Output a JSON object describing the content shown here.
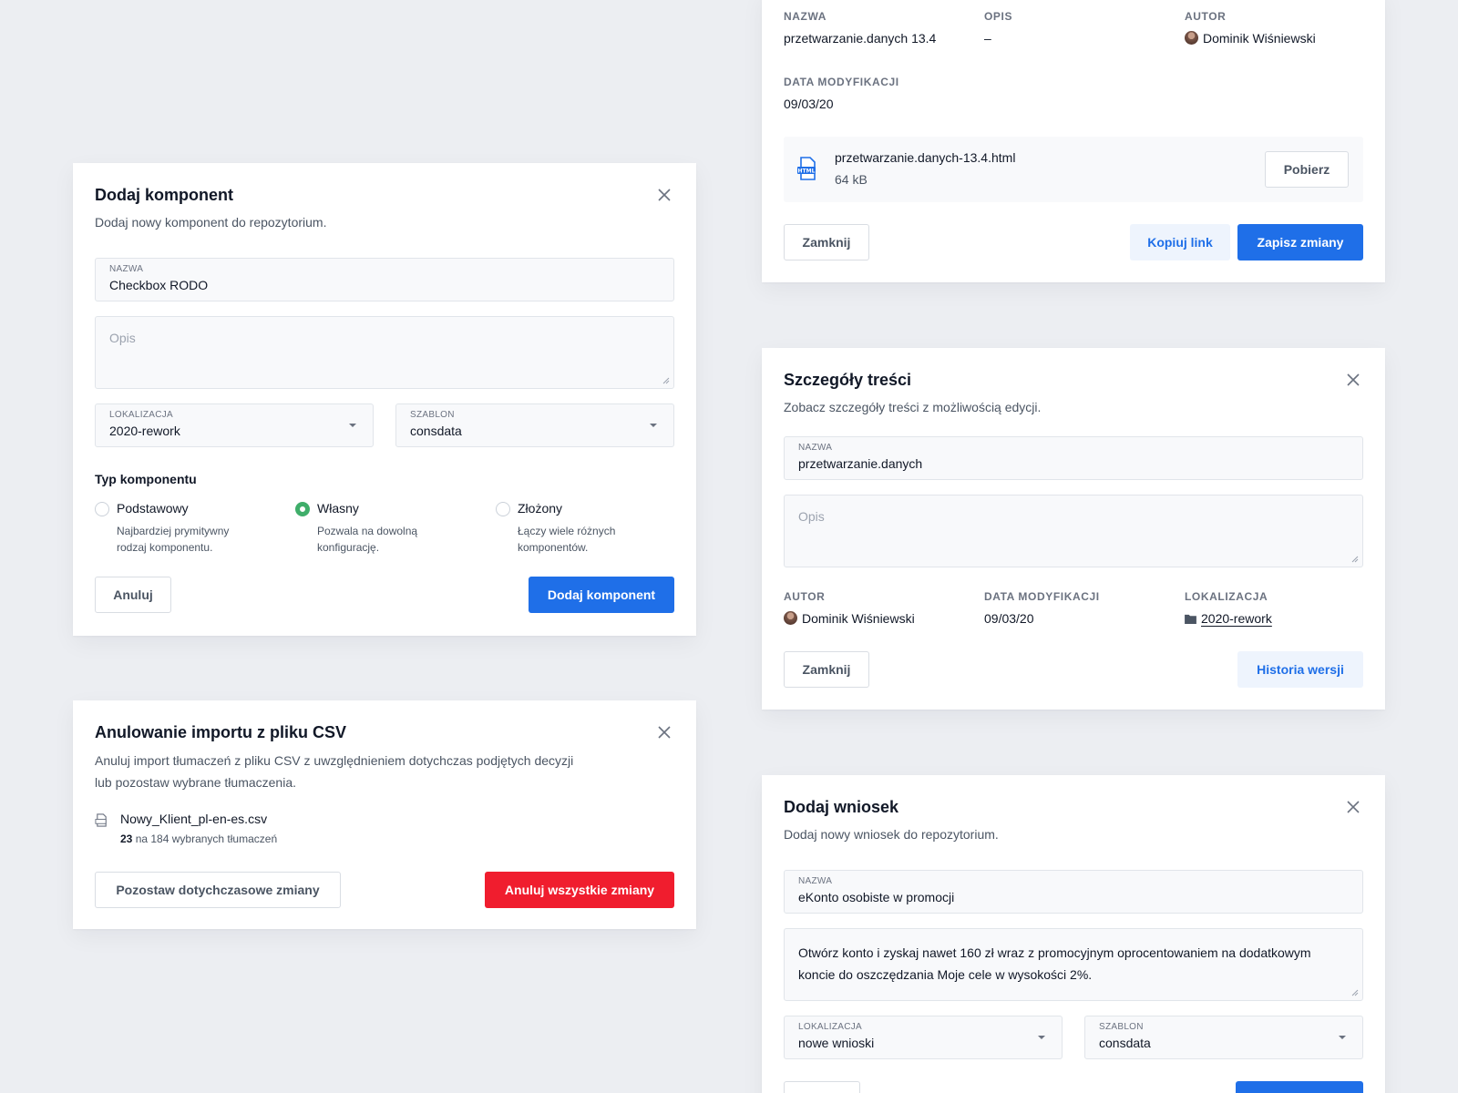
{
  "add_component": {
    "title": "Dodaj komponent",
    "subtitle": "Dodaj nowy komponent do repozytorium.",
    "name_label": "NAZWA",
    "name_value": "Checkbox RODO",
    "desc_placeholder": "Opis",
    "location_label": "LOKALIZACJA",
    "location_value": "2020-rework",
    "template_label": "SZABLON",
    "template_value": "consdata",
    "type_heading": "Typ komponentu",
    "types": [
      {
        "label": "Podstawowy",
        "desc1": "Najbardziej prymitywny",
        "desc2": "rodzaj komponentu.",
        "selected": false
      },
      {
        "label": "Własny",
        "desc1": "Pozwala na dowolną",
        "desc2": "konfigurację.",
        "selected": true
      },
      {
        "label": "Złożony",
        "desc1": "Łączy wiele różnych",
        "desc2": "komponentów.",
        "selected": false
      }
    ],
    "cancel_label": "Anuluj",
    "submit_label": "Dodaj komponent"
  },
  "cancel_import": {
    "title": "Anulowanie importu z pliku CSV",
    "subtitle_line1": "Anuluj import tłumaczeń z pliku CSV z uwzględnieniem dotychczas podjętych decyzji",
    "subtitle_line2": "lub pozostaw wybrane tłumaczenia.",
    "file_name": "Nowy_Klient_pl-en-es.csv",
    "count_selected": "23",
    "count_text": "na 184 wybranych tłumaczeń",
    "keep_label": "Pozostaw dotychczasowe zmiany",
    "cancel_all_label": "Anuluj wszystkie zmiany"
  },
  "file_details": {
    "name_label": "NAZWA",
    "name_value": "przetwarzanie.danych 13.4",
    "desc_label": "OPIS",
    "desc_value": "–",
    "author_label": "AUTOR",
    "author_value": "Dominik Wiśniewski",
    "modified_label": "DATA MODYFIKACJI",
    "modified_value": "09/03/20",
    "file_name": "przetwarzanie.danych-13.4.html",
    "file_size": "64 kB",
    "download_label": "Pobierz",
    "close_label": "Zamknij",
    "copy_link_label": "Kopiuj link",
    "save_label": "Zapisz zmiany"
  },
  "content_details": {
    "title": "Szczegóły treści",
    "subtitle": "Zobacz szczegóły treści z możliwością edycji.",
    "name_label": "NAZWA",
    "name_value": "przetwarzanie.danych",
    "desc_placeholder": "Opis",
    "author_label": "AUTOR",
    "author_value": "Dominik Wiśniewski",
    "modified_label": "DATA MODYFIKACJI",
    "modified_value": "09/03/20",
    "location_label": "LOKALIZACJA",
    "location_value": "2020-rework",
    "close_label": "Zamknij",
    "history_label": "Historia wersji"
  },
  "add_request": {
    "title": "Dodaj wniosek",
    "subtitle": "Dodaj nowy wniosek do repozytorium.",
    "name_label": "NAZWA",
    "name_value": "eKonto osobiste w promocji",
    "desc_value": "Otwórz konto i zyskaj nawet 160 zł wraz z promocyjnym oprocentowaniem na dodatkowym koncie do oszczędzania Moje cele w wysokości 2%.",
    "location_label": "LOKALIZACJA",
    "location_value": "nowe wnioski",
    "template_label": "SZABLON",
    "template_value": "consdata"
  },
  "colors": {
    "primary": "#1f6fe8",
    "danger": "#f01d2e",
    "success": "#3fae6a",
    "background": "#eceef2"
  }
}
